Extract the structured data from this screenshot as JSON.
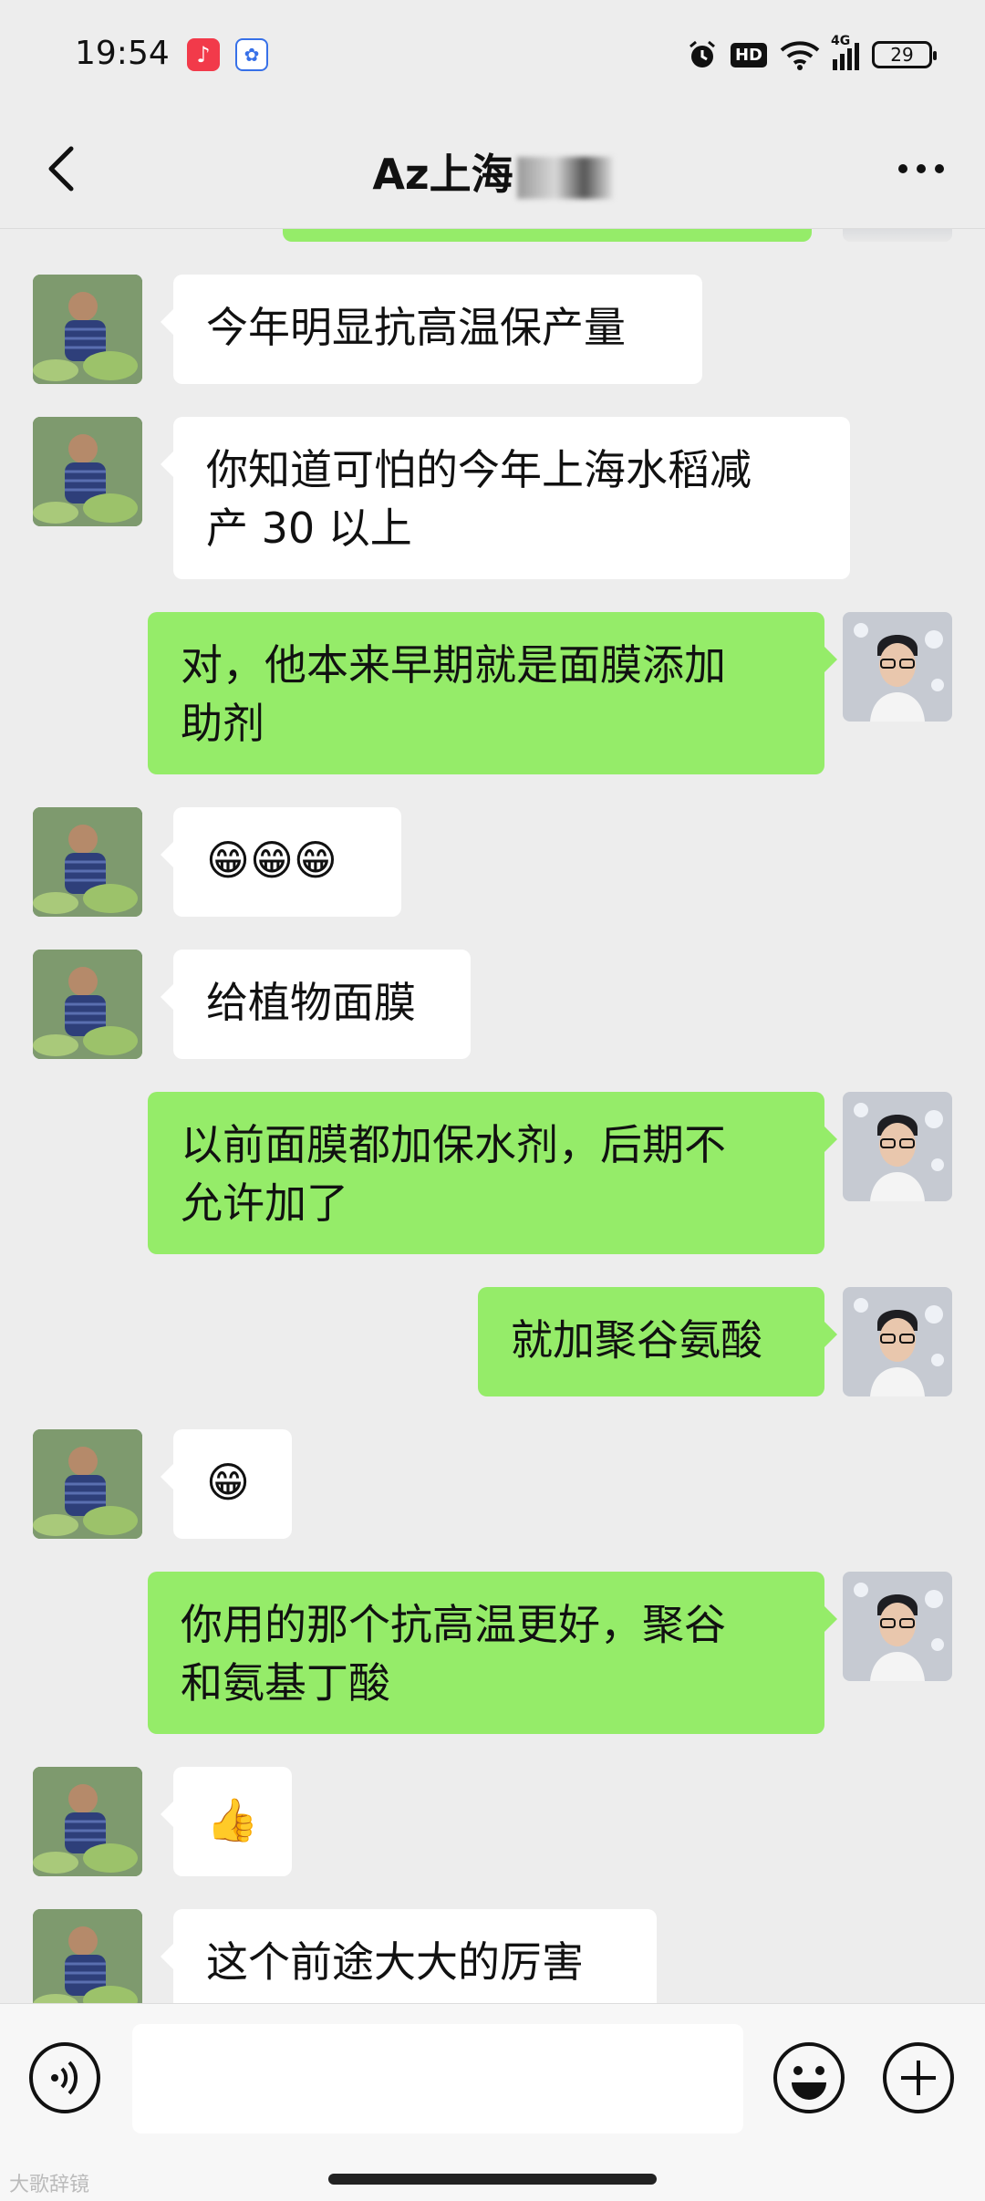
{
  "status": {
    "time": "19:54",
    "network": "HD",
    "signal": "4G",
    "battery": "29"
  },
  "header": {
    "title": "Az上海",
    "back_icon": "chevron-left-icon",
    "more_icon": "more-dots-icon"
  },
  "messages": [
    {
      "side": "left",
      "text": "今年明显抗高温保产量"
    },
    {
      "side": "left",
      "text": "你知道可怕的今年上海水稻减\n产 30 以上"
    },
    {
      "side": "right",
      "text": "对，他本来早期就是面膜添加\n助剂"
    },
    {
      "side": "left",
      "text": "😁😁😁"
    },
    {
      "side": "left",
      "text": "给植物面膜"
    },
    {
      "side": "right",
      "text": "以前面膜都加保水剂，后期不\n允许加了"
    },
    {
      "side": "right",
      "text": "就加聚谷氨酸"
    },
    {
      "side": "left",
      "text": "😁"
    },
    {
      "side": "right",
      "text": "你用的那个抗高温更好，聚谷\n和氨基丁酸"
    },
    {
      "side": "left",
      "text": "👍"
    },
    {
      "side": "left",
      "text": "这个前途大大的厉害"
    }
  ],
  "input": {
    "placeholder": "",
    "voice_icon": "voice-icon",
    "emoji_icon": "emoji-icon",
    "plus_icon": "plus-icon"
  },
  "watermark": "大歌辞镜",
  "colors": {
    "bubble_self": "#95ec69",
    "bubble_other": "#ffffff",
    "background": "#ededed"
  }
}
